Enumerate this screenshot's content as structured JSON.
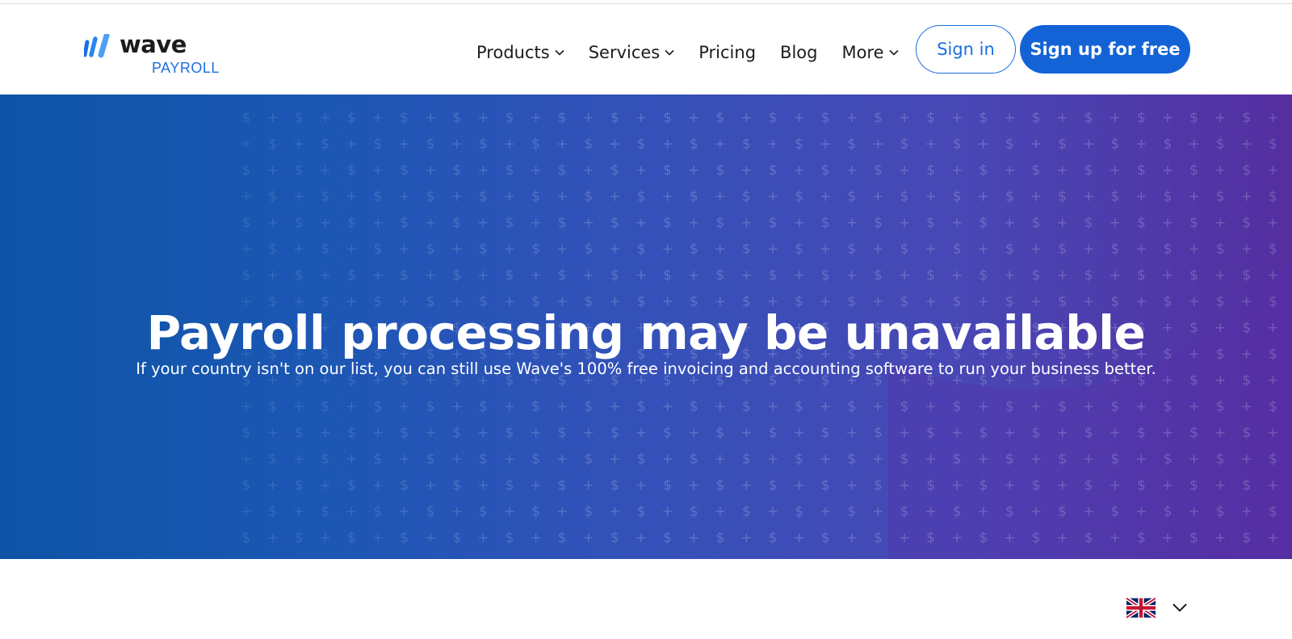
{
  "brand": {
    "name": "wave",
    "product": "PAYROLL",
    "primary_color": "#1363d6",
    "logo_icon": "wave-logo-icon"
  },
  "nav": {
    "items": [
      {
        "label": "Products",
        "has_dropdown": true
      },
      {
        "label": "Services",
        "has_dropdown": true
      },
      {
        "label": "Pricing",
        "has_dropdown": false
      },
      {
        "label": "Blog",
        "has_dropdown": false
      },
      {
        "label": "More",
        "has_dropdown": true
      }
    ]
  },
  "auth": {
    "signin_label": "Sign in",
    "signup_label": "Sign up for free"
  },
  "hero": {
    "title": "Payroll processing may be unavailable",
    "subtitle": "If your country isn't on our list, you can still use Wave's 100% free invoicing and accounting software to run your business better.",
    "gradient_start": "#0d54a6",
    "gradient_end": "#552ea0"
  },
  "footer": {
    "language_icon": "uk-flag-icon",
    "language_dropdown_icon": "chevron-down-icon"
  }
}
